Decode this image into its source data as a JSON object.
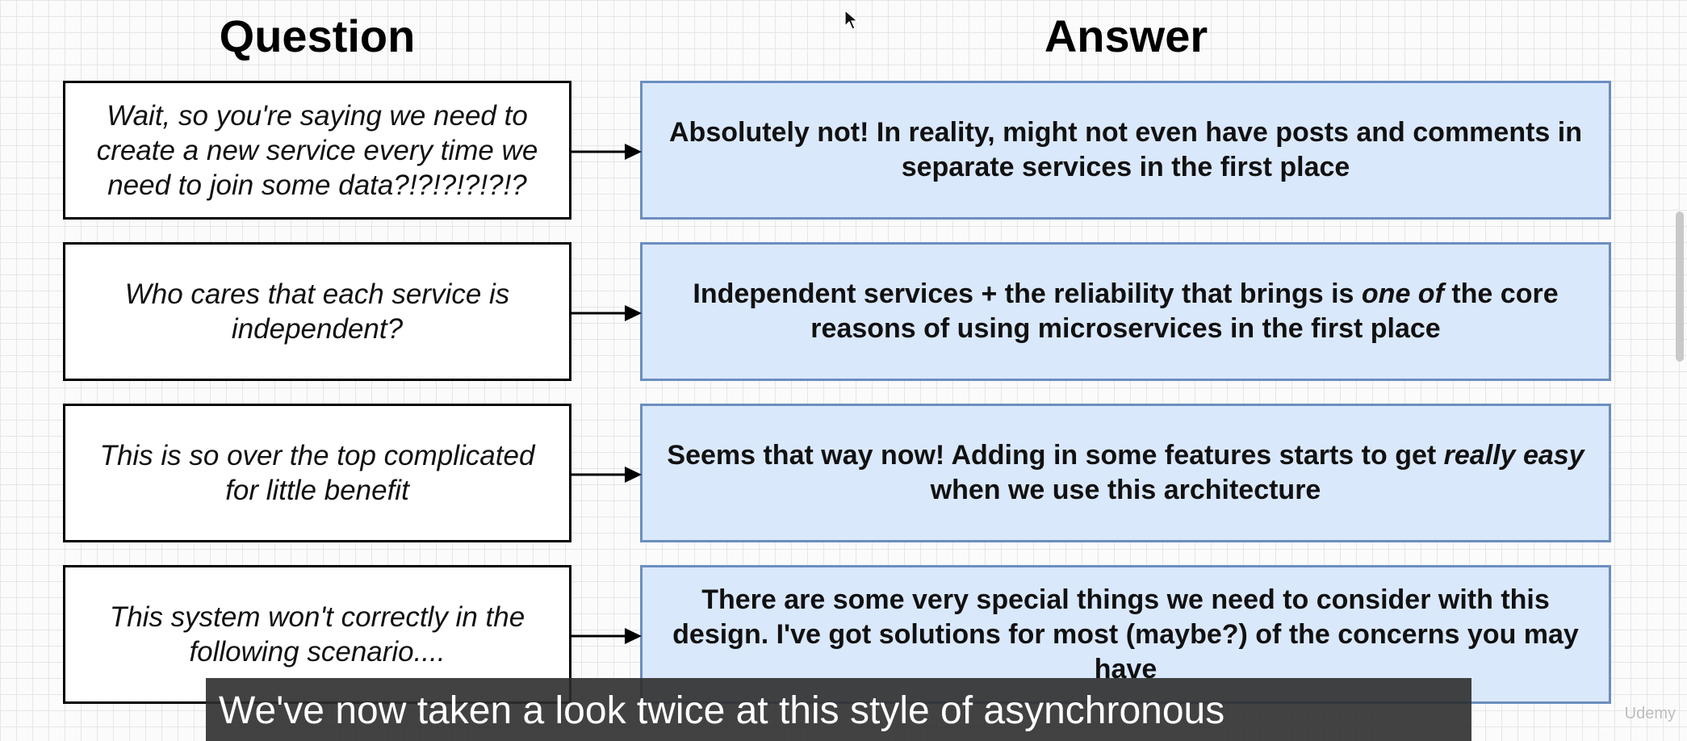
{
  "headings": {
    "question": "Question",
    "answer": "Answer"
  },
  "rows": [
    {
      "question": "Wait, so you're saying we need to create a new service every time we need to join some data?!?!?!?!?!?",
      "answer": [
        {
          "text": "Absolutely not!  In reality, might not even have posts and comments in separate services in the first place",
          "italic": false
        }
      ]
    },
    {
      "question": "Who cares that each service is independent?",
      "answer": [
        {
          "text": "Independent services + the reliability that brings is ",
          "italic": false
        },
        {
          "text": "one of",
          "italic": true
        },
        {
          "text": " the core reasons of using microservices in the first place",
          "italic": false
        }
      ]
    },
    {
      "question": "This is so over the top complicated for little benefit",
      "answer": [
        {
          "text": "Seems that way now!  Adding in some features starts to get ",
          "italic": false
        },
        {
          "text": "really easy",
          "italic": true
        },
        {
          "text": " when we use this architecture",
          "italic": false
        }
      ]
    },
    {
      "question": "This system won't correctly in the following scenario....",
      "answer": [
        {
          "text": "There are some very special things we need to consider with this design.  I've got solutions for most (maybe?) of the concerns you may have",
          "italic": false
        }
      ]
    }
  ],
  "subtitle": "We've now taken a look twice at this style of asynchronous",
  "watermark": "Udemy",
  "colors": {
    "answer_fill": "#dae8fc",
    "answer_border": "#6c8ebf",
    "question_border": "#000000",
    "subtitle_bg": "#2d2d2d"
  },
  "icons": {
    "pointer": "mouse-cursor-icon",
    "arrow": "arrow-right-icon"
  }
}
